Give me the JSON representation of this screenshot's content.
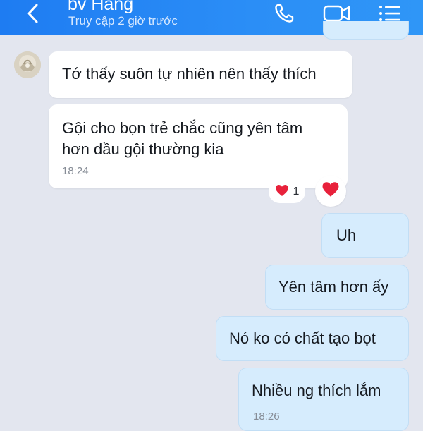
{
  "header": {
    "contact_name": "bv Hang",
    "status": "Truy cập 2 giờ trước"
  },
  "messages": {
    "m1": {
      "text": "Tớ thấy suôn tự nhiên nên thấy thích"
    },
    "m2": {
      "line1": "Gội cho bọn trẻ chắc cũng yên tâm",
      "line2": "hơn dầu gội thường kia",
      "time": "18:24"
    },
    "reaction": {
      "emoji": "heart",
      "count": "1"
    },
    "m3": {
      "text": "Uh"
    },
    "m4": {
      "text": "Yên tâm hơn ấy"
    },
    "m5": {
      "text": "Nó ko có chất tạo bọt"
    },
    "m6": {
      "text": "Nhiều ng thích lắm",
      "time": "18:26"
    }
  },
  "colors": {
    "header": "#1e7cf2",
    "chat_background": "#e3e6ef",
    "incoming_bubble": "#ffffff",
    "outgoing_bubble": "#d6ecfd",
    "heart": "#e8213b"
  },
  "icons": [
    "back-arrow-icon",
    "phone-icon",
    "video-call-icon",
    "menu-list-icon",
    "heart-icon"
  ]
}
